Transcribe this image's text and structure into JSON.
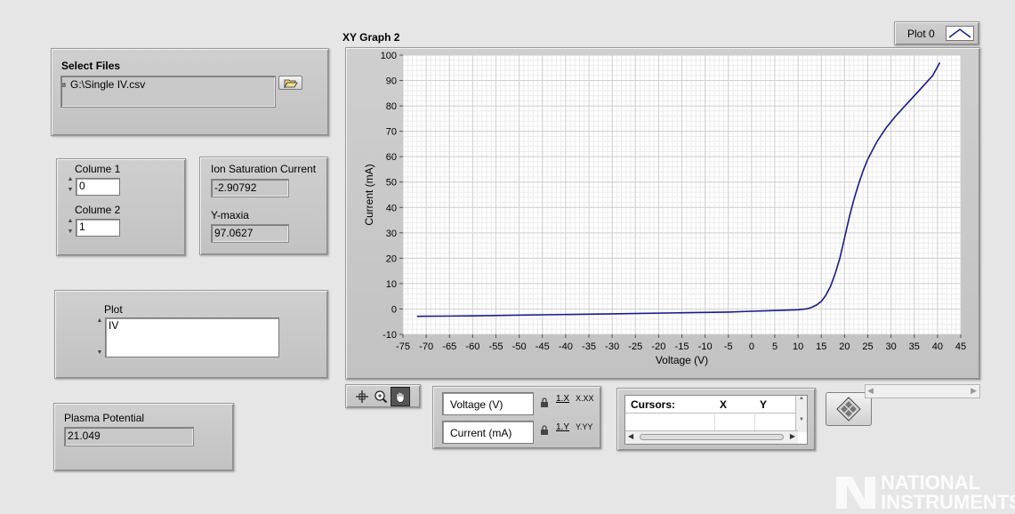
{
  "select_files": {
    "label": "Select Files",
    "path": "G:\\Single IV.csv",
    "path_prefix": "8"
  },
  "columns": {
    "col1_label": "Colume 1",
    "col1_value": "0",
    "col2_label": "Colume 2",
    "col2_value": "1"
  },
  "results": {
    "ion_sat_label": "Ion Saturation Current",
    "ion_sat_value": "-2.90792",
    "ymax_label": "Y-maxia",
    "ymax_value": "97.0627"
  },
  "plot_selector": {
    "label": "Plot",
    "value": "IV"
  },
  "plasma": {
    "label": "Plasma Potential",
    "value": "21.049"
  },
  "graph": {
    "title": "XY Graph 2",
    "legend_label": "Plot 0",
    "x_axis_name": "Voltage (V)",
    "y_axis_name": "Current (mA)",
    "x_scale_text": "1.X",
    "y_scale_text": "1.Y",
    "x_format_text": "X.XX",
    "y_format_text": "Y.YY"
  },
  "cursors": {
    "title": "Cursors:",
    "col_x": "X",
    "col_y": "Y"
  },
  "watermark": {
    "line1": "NATIONAL",
    "line2": "INSTRUMENTS"
  },
  "colors": {
    "plot_line": "#1a1a8c",
    "graph_bg": "#ffffff",
    "grid_major": "#d0d0d0",
    "grid_minor": "#ececec"
  },
  "chart_data": {
    "type": "line",
    "title": "XY Graph 2",
    "xlabel": "Voltage (V)",
    "ylabel": "Current (mA)",
    "xlim": [
      -75,
      45
    ],
    "ylim": [
      -10,
      100
    ],
    "x_ticks": [
      -75,
      -70,
      -65,
      -60,
      -55,
      -50,
      -45,
      -40,
      -35,
      -30,
      -25,
      -20,
      -15,
      -10,
      -5,
      0,
      5,
      10,
      15,
      20,
      25,
      30,
      35,
      40,
      45
    ],
    "y_ticks": [
      -10,
      0,
      10,
      20,
      30,
      40,
      50,
      60,
      70,
      80,
      90,
      100
    ],
    "grid": true,
    "legend": "top-right",
    "series": [
      {
        "name": "Plot 0",
        "x": [
          -72,
          -60,
          -45,
          -30,
          -15,
          -5,
          0,
          5,
          10,
          12,
          13,
          14,
          15,
          16,
          17,
          18,
          19,
          20,
          21,
          22,
          23,
          24,
          25,
          27,
          29,
          31,
          33,
          35,
          37,
          39,
          40.5
        ],
        "y": [
          -2.9,
          -2.7,
          -2.3,
          -1.9,
          -1.5,
          -1.2,
          -0.9,
          -0.6,
          -0.3,
          0.1,
          0.7,
          1.6,
          3,
          5.5,
          9,
          14,
          20,
          28,
          36,
          43,
          49,
          54.5,
          59,
          66,
          71.5,
          76,
          80,
          84,
          88,
          92,
          97.06
        ]
      }
    ]
  }
}
